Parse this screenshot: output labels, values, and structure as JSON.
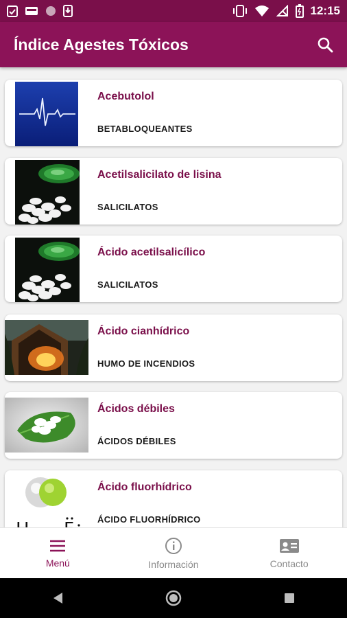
{
  "status_bar": {
    "time": "12:15",
    "left_icons": [
      "clipboard-check-icon",
      "cloud-icon",
      "circle-icon",
      "download-icon"
    ],
    "right_icons": [
      "vibrate-icon",
      "wifi-icon",
      "no-signal-icon",
      "battery-icon"
    ]
  },
  "app_bar": {
    "title": "Índice Agestes Tóxicos",
    "search_icon": "search-icon",
    "color": "#8c1358"
  },
  "items": [
    {
      "title": "Acebutolol",
      "category": "BETABLOQUEANTES",
      "image": "ecg-monitor"
    },
    {
      "title": "Acetilsalicilato de lisina",
      "category": "SALICILATOS",
      "image": "pill-bottle"
    },
    {
      "title": "Ácido acetilsalicílico",
      "category": "SALICILATOS",
      "image": "pill-bottle"
    },
    {
      "title": "Ácido cianhídrico",
      "category": "HUMO DE INCENDIOS",
      "image": "burning-house"
    },
    {
      "title": "Ácidos débiles",
      "category": "ÁCIDOS DÉBILES",
      "image": "pills-on-leaf"
    },
    {
      "title": "Ácido fluorhídrico",
      "category": "ÁCIDO FLUORHÍDRICO",
      "image": "hf-molecule"
    }
  ],
  "bottom_nav": {
    "menu": "Menú",
    "info": "Información",
    "contact": "Contacto",
    "active": "menu"
  },
  "colors": {
    "primary": "#8c1358",
    "status_bar": "#7a0f4a",
    "title_text": "#7a0f4a"
  }
}
